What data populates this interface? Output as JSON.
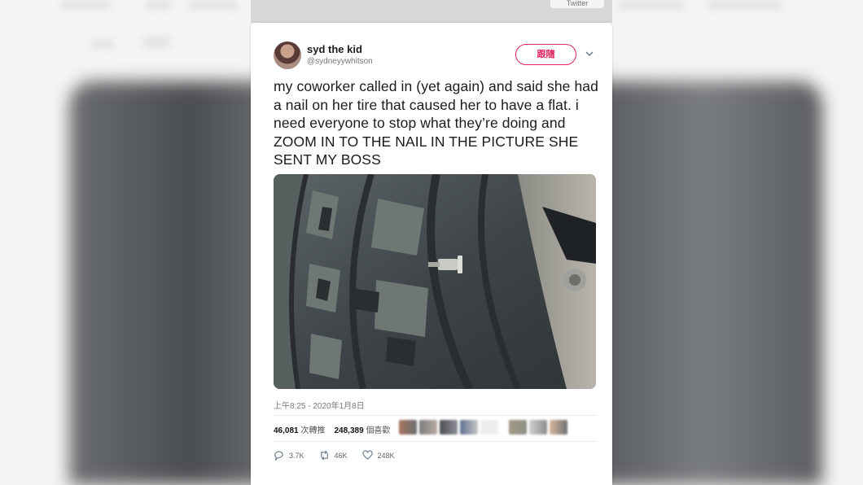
{
  "source_label": "Twitter",
  "tweet": {
    "display_name": "syd the kid",
    "handle": "@sydneyywhitson",
    "follow_label": "跟隨",
    "text": "my coworker called in (yet again) and said she had a nail on her tire that caused her to have a flat. i need everyone to stop what they’re doing and ZOOM IN TO THE NAIL IN THE PICTURE SHE SENT MY BOSS",
    "timestamp": "上午8:25 - 2020年1月8日",
    "stats": {
      "retweets_value": "46,081",
      "retweets_label": "次轉推",
      "likes_value": "248,389",
      "likes_label": "個喜歡"
    },
    "actions": {
      "reply_count": "3.7K",
      "retweet_count": "46K",
      "like_count": "248K"
    }
  },
  "colors": {
    "follow_accent": "#e0245e",
    "text": "#1b1b1b",
    "muted": "#777777"
  },
  "icons": {
    "reply": "reply-icon",
    "retweet": "retweet-icon",
    "like": "heart-icon",
    "more": "chevron-down-icon"
  }
}
